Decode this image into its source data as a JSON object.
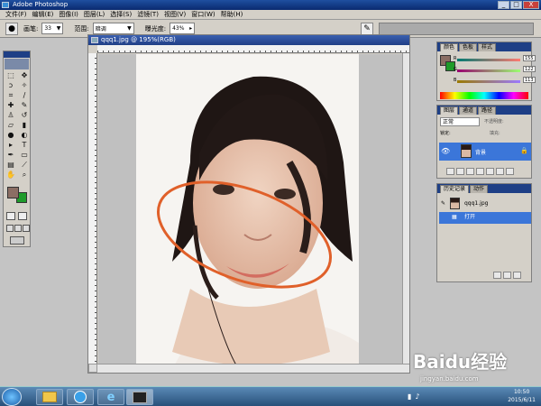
{
  "app": {
    "title": "Adobe Photoshop"
  },
  "window_buttons": {
    "minimize": "_",
    "maximize": "□",
    "close": "X"
  },
  "menu": [
    "文件(F)",
    "编辑(E)",
    "图像(I)",
    "图层(L)",
    "选择(S)",
    "滤镜(T)",
    "视图(V)",
    "窗口(W)",
    "帮助(H)"
  ],
  "options": {
    "brush_label": "画笔:",
    "brush_size": "33",
    "range_label": "范围:",
    "range_value": "暗调",
    "exposure_label": "曝光度:",
    "exposure_value": "43%"
  },
  "document": {
    "title": "qqq1.jpg @ 195%(RGB)"
  },
  "color_panel": {
    "tabs": [
      "颜色",
      "色板",
      "样式"
    ],
    "channels": [
      {
        "label": "R",
        "value": "155"
      },
      {
        "label": "G",
        "value": "122"
      },
      {
        "label": "B",
        "value": "113"
      }
    ],
    "foreground": "#8b6e64",
    "background": "#1f9b2a"
  },
  "layers_panel": {
    "tabs": [
      "图层",
      "通道",
      "路径"
    ],
    "blend_mode": "正常",
    "opacity_label": "不透明度:",
    "lock_label": "锁定:",
    "fill_label": "填充:",
    "layer_name": "背景"
  },
  "history_panel": {
    "tabs": [
      "历史记录",
      "动作"
    ],
    "snapshot": "qqq1.jpg",
    "items": [
      "打开"
    ]
  },
  "taskbar": {
    "time": "10:50",
    "date": "2015/6/11"
  },
  "watermark": {
    "brand": "Baidu经验",
    "url": "jingyan.baidu.com"
  },
  "colors": {
    "annotation_ellipse": "#e0602a",
    "selection": "#3b76d9"
  },
  "icons": {
    "tools": [
      "marquee-icon",
      "move-icon",
      "lasso-icon",
      "magic-wand-icon",
      "crop-icon",
      "slice-icon",
      "healing-icon",
      "brush-icon",
      "stamp-icon",
      "history-brush-icon",
      "eraser-icon",
      "gradient-icon",
      "dodge-icon",
      "burn-icon",
      "path-icon",
      "type-icon",
      "pen-icon",
      "shape-icon",
      "notes-icon",
      "eyedropper-icon",
      "hand-icon",
      "zoom-icon"
    ]
  }
}
